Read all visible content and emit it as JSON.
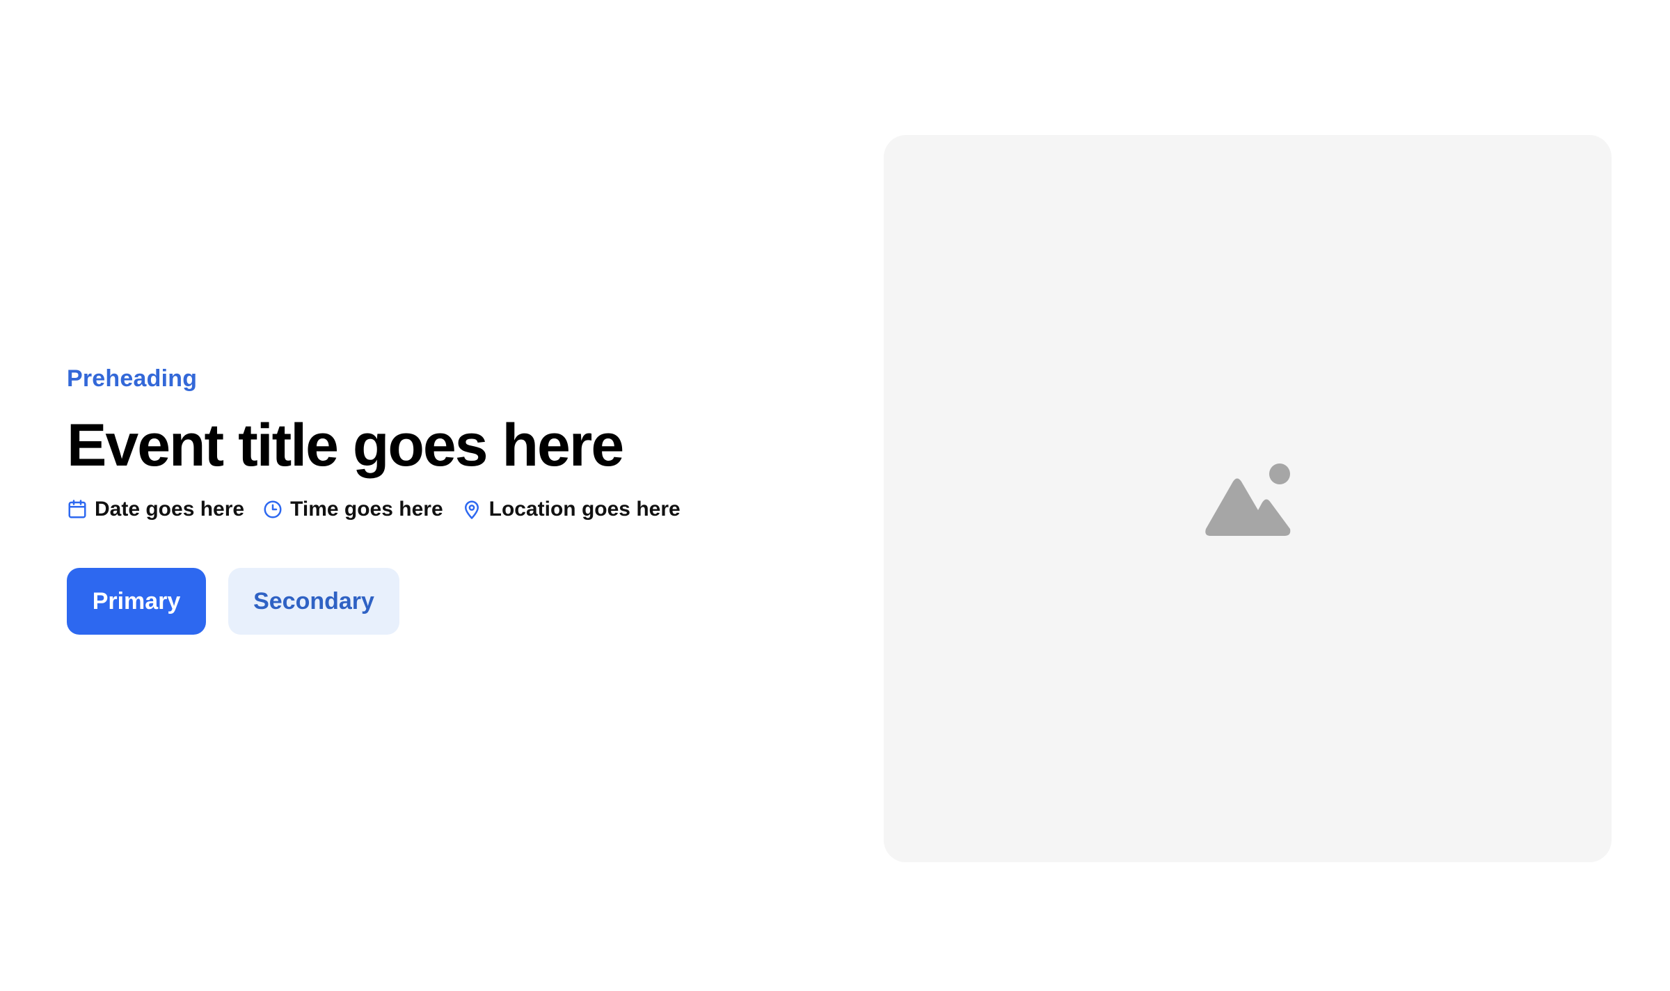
{
  "event": {
    "preheading": "Preheading",
    "title": "Event title goes here",
    "meta": {
      "date": "Date goes here",
      "time": "Time goes here",
      "location": "Location goes here"
    },
    "icons": {
      "date": "calendar-icon",
      "time": "clock-icon",
      "location": "map-pin-icon"
    }
  },
  "buttons": {
    "primary_label": "Primary",
    "secondary_label": "Secondary"
  },
  "media": {
    "icon": "image-placeholder-icon"
  },
  "colors": {
    "accent": "#2d68f0",
    "preheading": "#3368d8",
    "secondary_bg": "#e8f0fc",
    "secondary_text": "#2f62c4",
    "panel_bg": "#f5f5f5",
    "placeholder_icon": "#a6a6a6"
  }
}
